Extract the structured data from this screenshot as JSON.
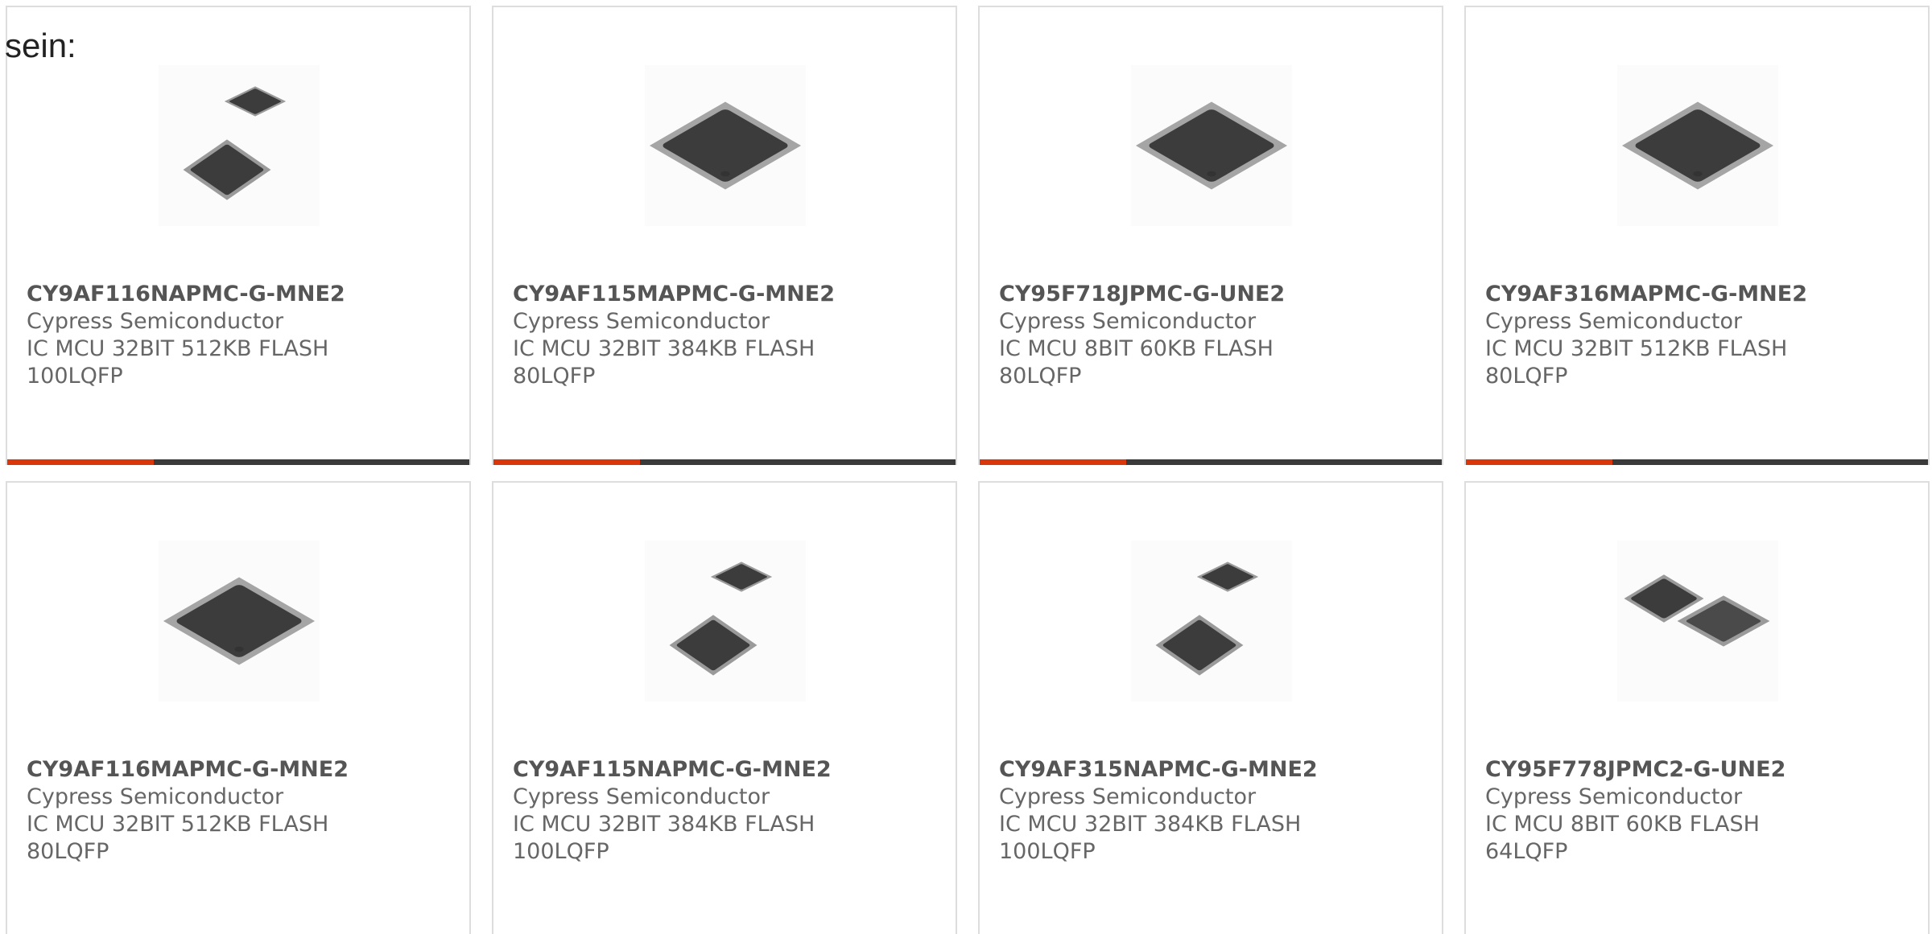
{
  "intro_text": "sein:",
  "colors": {
    "accent": "#d9360b",
    "bar": "#3a3a3a",
    "chip": "#3c3c3c",
    "border": "#dddddd",
    "text": "#555555"
  },
  "products": [
    {
      "part_number": "CY9AF116NAPMC-G-MNE2",
      "manufacturer": "Cypress Semiconductor",
      "description_line1": "IC MCU 32BIT 512KB FLASH",
      "description_line2": "100LQFP",
      "image_icon": "two-ic-chips-stacked-icon"
    },
    {
      "part_number": "CY9AF115MAPMC-G-MNE2",
      "manufacturer": "Cypress Semiconductor",
      "description_line1": "IC MCU 32BIT 384KB FLASH",
      "description_line2": "80LQFP",
      "image_icon": "lqfp-chip-icon"
    },
    {
      "part_number": "CY95F718JPMC-G-UNE2",
      "manufacturer": "Cypress Semiconductor",
      "description_line1": "IC MCU 8BIT 60KB FLASH",
      "description_line2": "80LQFP",
      "image_icon": "lqfp-chip-icon"
    },
    {
      "part_number": "CY9AF316MAPMC-G-MNE2",
      "manufacturer": "Cypress Semiconductor",
      "description_line1": "IC MCU 32BIT 512KB FLASH",
      "description_line2": "80LQFP",
      "image_icon": "lqfp-chip-icon"
    },
    {
      "part_number": "CY9AF116MAPMC-G-MNE2",
      "manufacturer": "Cypress Semiconductor",
      "description_line1": "IC MCU 32BIT 512KB FLASH",
      "description_line2": "80LQFP",
      "image_icon": "lqfp-chip-icon"
    },
    {
      "part_number": "CY9AF115NAPMC-G-MNE2",
      "manufacturer": "Cypress Semiconductor",
      "description_line1": "IC MCU 32BIT 384KB FLASH",
      "description_line2": "100LQFP",
      "image_icon": "two-ic-chips-stacked-icon"
    },
    {
      "part_number": "CY9AF315NAPMC-G-MNE2",
      "manufacturer": "Cypress Semiconductor",
      "description_line1": "IC MCU 32BIT 384KB FLASH",
      "description_line2": "100LQFP",
      "image_icon": "two-ic-chips-stacked-icon"
    },
    {
      "part_number": "CY95F778JPMC2-G-UNE2",
      "manufacturer": "Cypress Semiconductor",
      "description_line1": "IC MCU 8BIT 60KB FLASH",
      "description_line2": "64LQFP",
      "image_icon": "two-ic-chips-side-icon"
    }
  ]
}
